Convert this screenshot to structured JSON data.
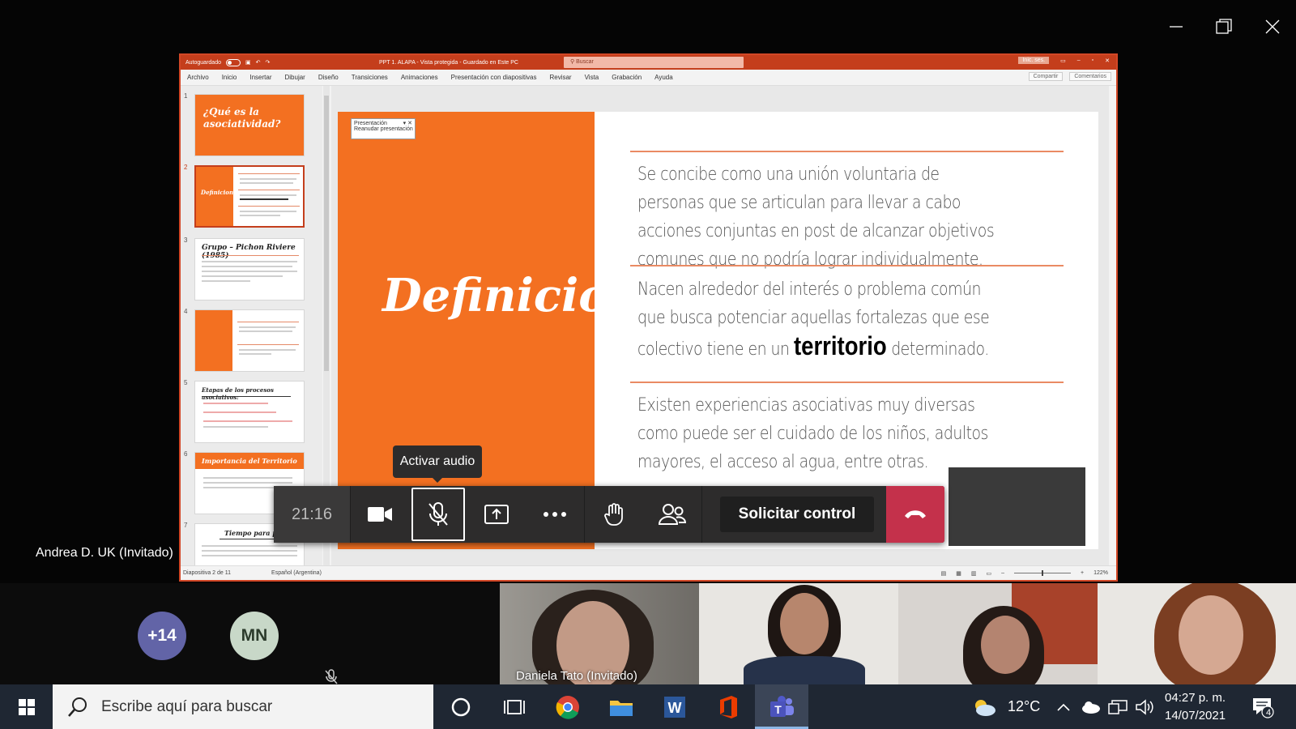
{
  "window": {
    "minimize": "minimize",
    "maximize": "maximize",
    "close": "close"
  },
  "ppt": {
    "autosave_label": "Autoguardado",
    "doc_title": "PPT 1. ALAPA - Vista protegida - Guardado en Este PC",
    "search_placeholder": "Buscar",
    "signin": "Inic. ses.",
    "menu": [
      "Archivo",
      "Inicio",
      "Insertar",
      "Dibujar",
      "Diseño",
      "Transiciones",
      "Animaciones",
      "Presentación con diapositivas",
      "Revisar",
      "Vista",
      "Grabación",
      "Ayuda"
    ],
    "share": "Compartir",
    "comments": "Comentarios",
    "thumbnails": [
      {
        "num": "1",
        "title": "¿Qué es la asociatividad?"
      },
      {
        "num": "2",
        "title": "Definiciones:"
      },
      {
        "num": "3",
        "title": "Grupo – Pichon Riviere (1985)"
      },
      {
        "num": "4",
        "title": ""
      },
      {
        "num": "5",
        "title": "Etapas de los procesos asociativos:"
      },
      {
        "num": "6",
        "title": "Importancia del Territorio"
      },
      {
        "num": "7",
        "title": "Tiempo para pensar"
      }
    ],
    "popup": {
      "title": "Presentación",
      "action": "Reanudar presentación"
    },
    "slide": {
      "heading": "Definiciones:",
      "p1": "Se concibe como una unión voluntaria de personas que se articulan para llevar a cabo acciones conjuntas en post de alcanzar objetivos comunes que no podría lograr individualmente.",
      "p2a": "Nacen alrededor del interés o problema común que busca potenciar aquellas fortalezas que ese colectivo tiene en un",
      "p2b": "territorio",
      "p2c": "determinado.",
      "p3": "Existen experiencias asociativas muy diversas como puede ser el cuidado de los niños, adultos mayores, el acceso al agua, entre otras."
    },
    "status": {
      "slide": "Diapositiva 2 de 11",
      "lang": "Español (Argentina)",
      "zoom": "122%"
    }
  },
  "meeting": {
    "timer": "21:16",
    "tooltip": "Activar audio",
    "request_control": "Solicitar control",
    "presenter": "Andrea D. UK (Invitado)",
    "more_count": "+14",
    "initials": "MN",
    "video_label": "Daniela Tato (Invitado)"
  },
  "taskbar": {
    "search_placeholder": "Escribe aquí para buscar",
    "temp": "12°C",
    "time": "04:27 p. m.",
    "date": "14/07/2021",
    "notif_count": "4"
  },
  "colors": {
    "accent_orange": "#f37021",
    "ppt_red": "#c43e1c",
    "hangup": "#c4314b",
    "avatar_more": "#6264a7",
    "avatar_mn": "#c8d8c8"
  }
}
